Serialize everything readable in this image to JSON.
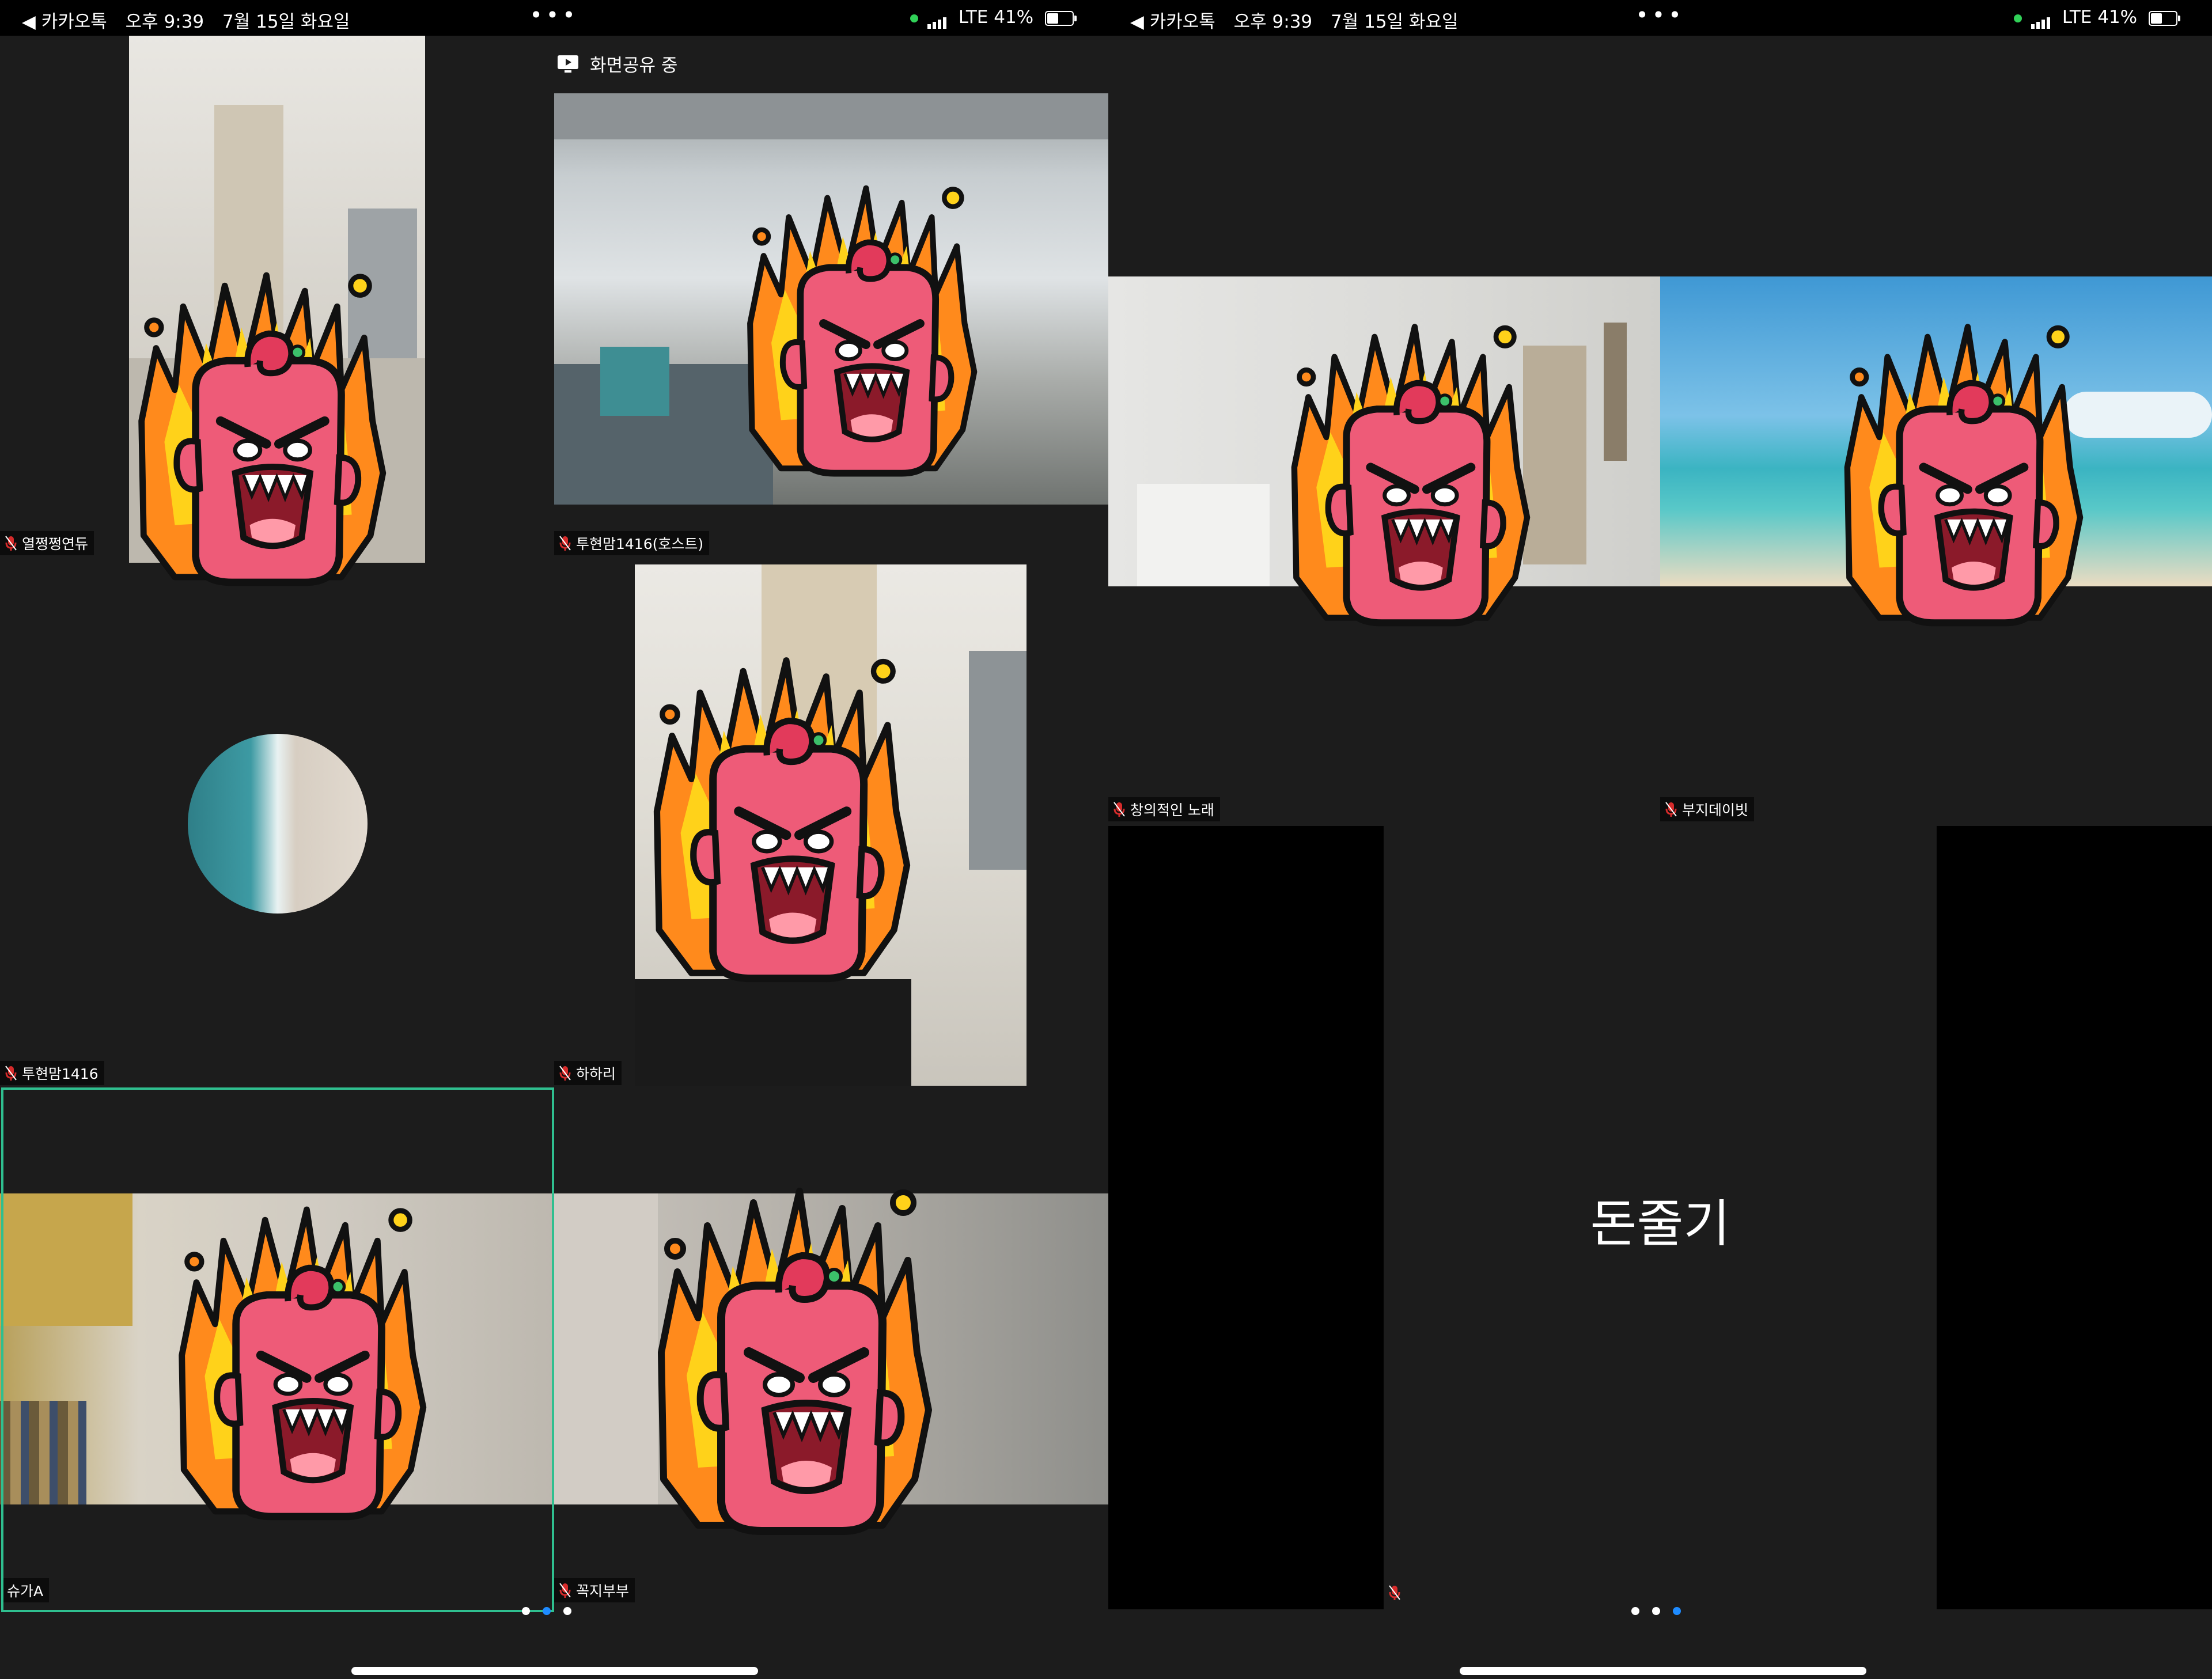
{
  "status_bar": {
    "back_app": "◀ 카카오톡",
    "time": "오후 9:39",
    "date": "7월 15일 화요일",
    "more": "•••",
    "network": "LTE",
    "battery": "41%"
  },
  "left_screen": {
    "share_indicator": "화면공유 중",
    "participants": [
      {
        "name": "열쩡쩡연듀"
      },
      {
        "name": "투현맘1416(호스트)"
      },
      {
        "name": "투현맘1416"
      },
      {
        "name": "하하리"
      },
      {
        "name": "슈가A"
      },
      {
        "name": "꼭지부부"
      }
    ],
    "page_dots": {
      "count": 3,
      "active": 2
    }
  },
  "right_screen": {
    "participants": [
      {
        "name": "창의적인 노래"
      },
      {
        "name": "부지데이빗"
      },
      {
        "name": "돈줄기",
        "displayed_large": "돈줄기"
      }
    ],
    "page_dots": {
      "count": 3,
      "active": 3
    }
  },
  "colors": {
    "background": "#1c1c1c",
    "active_speaker_border": "#2fbf8f",
    "avatar_face": "#ee5b78",
    "flame_outer": "#ff8a1c",
    "flame_inner": "#ffd21a",
    "dot_active": "#1e8bff"
  },
  "icons": [
    "mic-muted-icon",
    "screen-share-icon",
    "signal-icon",
    "battery-icon"
  ]
}
